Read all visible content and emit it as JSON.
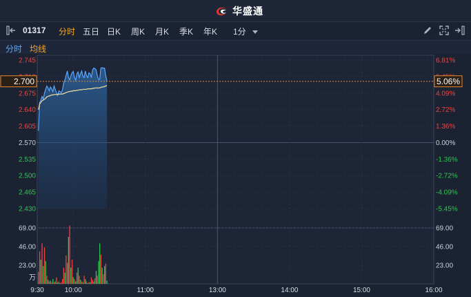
{
  "header": {
    "brand": "华盛通"
  },
  "toolbar": {
    "stock_code": "01317",
    "tabs": [
      "分时",
      "五日",
      "日K",
      "周K",
      "月K",
      "季K",
      "年K"
    ],
    "active_tab": "分时",
    "interval": "1分"
  },
  "legend": {
    "time_label": "分时",
    "avg_label": "均线"
  },
  "colors": {
    "up": "#f0433e",
    "down": "#2fc44f",
    "neutral": "#c9d1dc",
    "price_line": "#59a8ff",
    "avg_line": "#f3e3a1",
    "cursor": "#e88a2c",
    "active": "#f5a623"
  },
  "chart_data": {
    "type": "line",
    "title": "",
    "price_axis": {
      "labels": [
        "2.745",
        "2.710",
        "2.675",
        "2.640",
        "2.605",
        "2.570",
        "2.535",
        "2.500",
        "2.465",
        "2.430"
      ],
      "values": [
        2.745,
        2.71,
        2.675,
        2.64,
        2.605,
        2.57,
        2.535,
        2.5,
        2.465,
        2.43
      ],
      "ylim": [
        2.43,
        2.745
      ]
    },
    "pct_axis": {
      "labels": [
        "6.81%",
        "5.45%",
        "4.09%",
        "2.72%",
        "1.36%",
        "0.00%",
        "-1.36%",
        "-2.72%",
        "-4.09%",
        "-5.45%"
      ]
    },
    "prev_close": 2.57,
    "cursor": {
      "price": "2.700",
      "pct": "5.06%"
    },
    "time_axis": {
      "labels": [
        "9:30",
        "10:00",
        "11:00",
        "13:00",
        "14:00",
        "15:00",
        "16:00"
      ],
      "positions_min": [
        0,
        30,
        90,
        150,
        210,
        270,
        330
      ],
      "total_min": 330
    },
    "price": [
      2.595,
      2.655,
      2.66,
      2.668,
      2.662,
      2.675,
      2.683,
      2.69,
      2.686,
      2.68,
      2.688,
      2.684,
      2.678,
      2.69,
      2.683,
      2.676,
      2.67,
      2.68,
      2.678,
      2.676,
      2.682,
      2.696,
      2.703,
      2.712,
      2.722,
      2.708,
      2.703,
      2.712,
      2.718,
      2.721,
      2.708,
      2.702,
      2.716,
      2.72,
      2.708,
      2.716,
      2.722,
      2.711,
      2.708,
      2.722,
      2.712,
      2.708,
      2.718,
      2.716,
      2.708,
      2.724,
      2.728,
      2.727,
      2.724,
      2.712,
      2.704,
      2.704,
      2.728,
      2.729,
      2.728,
      2.728,
      2.712,
      2.7
    ],
    "avg": [
      2.64,
      2.652,
      2.655,
      2.659,
      2.66,
      2.662,
      2.664,
      2.667,
      2.668,
      2.669,
      2.67,
      2.671,
      2.671,
      2.672,
      2.672,
      2.672,
      2.672,
      2.673,
      2.673,
      2.673,
      2.673,
      2.674,
      2.675,
      2.676,
      2.677,
      2.678,
      2.678,
      2.679,
      2.679,
      2.68,
      2.68,
      2.68,
      2.681,
      2.681,
      2.682,
      2.682,
      2.682,
      2.683,
      2.683,
      2.683,
      2.683,
      2.684,
      2.684,
      2.684,
      2.684,
      2.685,
      2.685,
      2.686,
      2.686,
      2.686,
      2.686,
      2.686,
      2.687,
      2.688,
      2.688,
      2.689,
      2.69,
      2.691
    ],
    "volume_axis": {
      "labels": [
        "69.00",
        "46.00",
        "23.00"
      ],
      "values": [
        69,
        46,
        23
      ],
      "unit": "万",
      "ylim": [
        0,
        69
      ]
    },
    "volume": [
      15,
      40,
      30,
      50,
      22,
      45,
      28,
      10,
      5,
      3,
      4,
      2,
      6,
      2,
      3,
      8,
      2,
      3,
      1,
      2,
      6,
      20,
      14,
      35,
      26,
      58,
      72,
      20,
      30,
      8,
      6,
      3,
      14,
      20,
      10,
      5,
      3,
      2,
      10,
      6,
      3,
      1,
      2,
      2,
      8,
      5,
      3,
      7,
      16,
      10,
      28,
      50,
      36,
      20,
      12,
      22,
      25,
      4
    ],
    "volume_dir": [
      "u",
      "u",
      "d",
      "u",
      "d",
      "u",
      "d",
      "u",
      "d",
      "u",
      "d",
      "u",
      "d",
      "u",
      "d",
      "u",
      "d",
      "u",
      "d",
      "u",
      "u",
      "u",
      "d",
      "u",
      "u",
      "d",
      "u",
      "d",
      "u",
      "d",
      "u",
      "d",
      "u",
      "d",
      "u",
      "d",
      "u",
      "d",
      "u",
      "d",
      "u",
      "d",
      "u",
      "d",
      "u",
      "u",
      "d",
      "u",
      "d",
      "u",
      "d",
      "d",
      "u",
      "d",
      "u",
      "d",
      "u",
      "d"
    ]
  }
}
